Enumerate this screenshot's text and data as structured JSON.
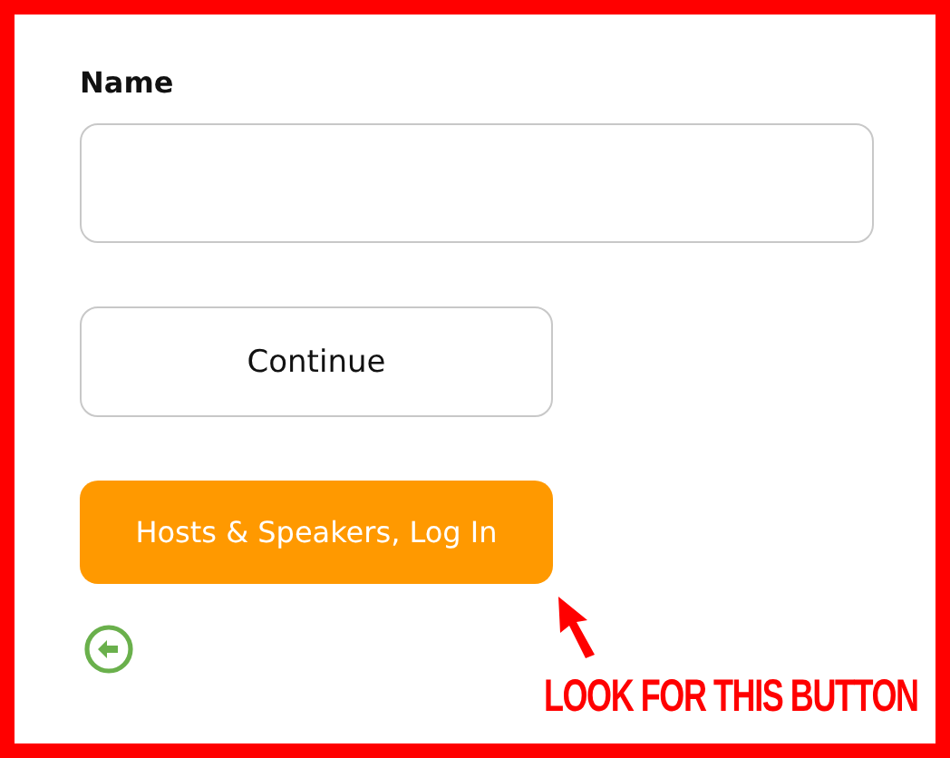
{
  "form": {
    "name_label": "Name",
    "continue_button": "Continue",
    "login_button": "Hosts & Speakers, Log In"
  },
  "annotation": {
    "text": "LOOK FOR THIS BUTTON"
  }
}
